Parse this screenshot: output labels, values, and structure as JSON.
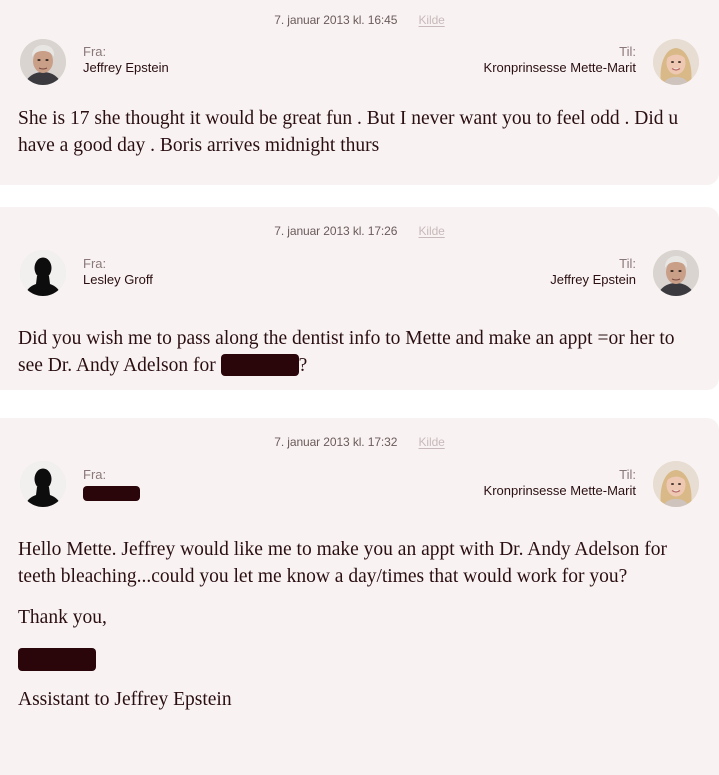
{
  "source_label": "Kilde",
  "emails": [
    {
      "timestamp": "7. januar 2013 kl. 16:45",
      "from_label": "Fra:",
      "from_name": "Jeffrey Epstein",
      "to_label": "Til:",
      "to_name": "Kronprinsesse Mette-Marit",
      "body": "She is 17 she thought it would be great fun . But I never want you to feel odd . Did u have a good day . Boris arrives midnight thurs"
    },
    {
      "timestamp": "7. januar 2013 kl. 17:26",
      "from_label": "Fra:",
      "from_name": "Lesley Groff",
      "to_label": "Til:",
      "to_name": "Jeffrey Epstein",
      "body_before": "Did you wish me to pass along the dentist info to Mette and make an appt =or her to see Dr. Andy Adelson for ",
      "body_after": "?"
    },
    {
      "timestamp": "7. januar 2013 kl. 17:32",
      "from_label": "Fra:",
      "to_label": "Til:",
      "to_name": "Kronprinsesse Mette-Marit",
      "body_p1": "Hello Mette. Jeffrey would like me to make you an appt with Dr. Andy Adelson for teeth bleaching...could you let me know a day/times that would work for you?",
      "body_p2": "Thank you,",
      "body_p4": "Assistant to Jeffrey Epstein"
    }
  ],
  "colors": {
    "card_bg": "#f8f3f2",
    "text": "#2a0e12",
    "muted": "#6b5a5c",
    "link": "#c8b9bb",
    "redaction": "#2a050a"
  },
  "icons": {
    "avatar_epstein": "photo-portrait",
    "avatar_unknown": "silhouette-portrait",
    "avatar_mette_marit": "photo-portrait"
  }
}
